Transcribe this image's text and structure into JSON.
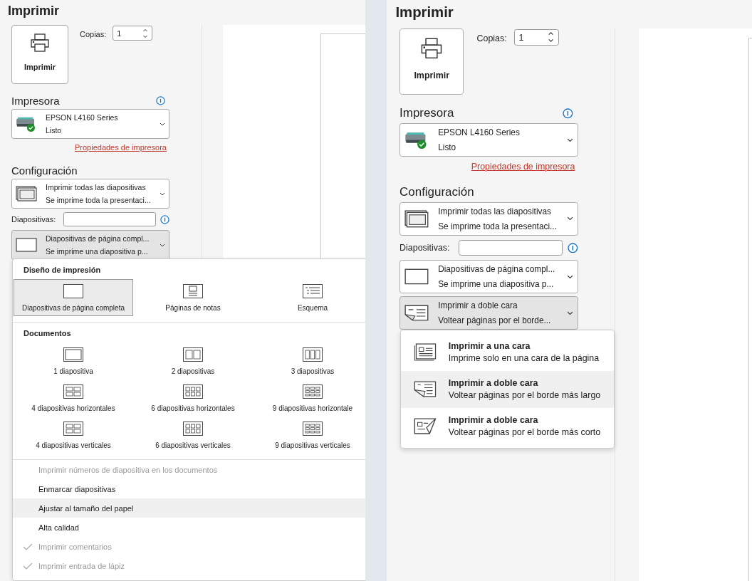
{
  "panels": [
    {
      "title": "Imprimir",
      "print_button": "Imprimir",
      "copies_label": "Copias:",
      "copies_value": "1",
      "printer_heading": "Impresora",
      "printer": {
        "name": "EPSON L4160 Series",
        "status": "Listo"
      },
      "printer_properties_link": "Propiedades de impresora",
      "settings_heading": "Configuración",
      "settings": [
        {
          "kind": "range",
          "title": "Imprimir todas las diapositivas",
          "subtitle": "Se imprime toda la presentaci...",
          "expanded": false
        },
        {
          "kind": "slides",
          "label": "Diapositivas:"
        },
        {
          "kind": "layout",
          "title": "Diapositivas de página compl...",
          "subtitle": "Se imprime una diapositiva p...",
          "expanded": true,
          "menu": {
            "kind": "layout-grid",
            "sections": [
              {
                "heading": "Diseño de impresión",
                "options": [
                  {
                    "kind": "full",
                    "label": "Diapositivas de página completa",
                    "selected": true
                  },
                  {
                    "kind": "notes",
                    "label": "Páginas de notas",
                    "selected": false
                  },
                  {
                    "kind": "outline",
                    "label": "Esquema",
                    "selected": false
                  }
                ]
              },
              {
                "heading": "Documentos",
                "options": [
                  {
                    "kind": "single",
                    "label": "1 diapositiva",
                    "selected": false
                  },
                  {
                    "kind": "double",
                    "label": "2 diapositivas",
                    "selected": false
                  },
                  {
                    "kind": "triple",
                    "label": "3 diapositivas",
                    "selected": false
                  },
                  {
                    "kind": "fourwide",
                    "label": "4 diapositivas horizontales",
                    "selected": false
                  },
                  {
                    "kind": "sixwide",
                    "label": "6 diapositivas horizontales",
                    "selected": false
                  },
                  {
                    "kind": "ninewide",
                    "label": "9 diapositivas horizontale",
                    "selected": false
                  },
                  {
                    "kind": "fourtall",
                    "label": "4 diapositivas verticales",
                    "selected": false
                  },
                  {
                    "kind": "sixtall",
                    "label": "6 diapositivas verticales",
                    "selected": false
                  },
                  {
                    "kind": "ninetall",
                    "label": "9 diapositivas verticales",
                    "selected": false
                  }
                ]
              }
            ],
            "toggles": [
              {
                "label": "Imprimir números de diapositiva en los documentos",
                "checked": false,
                "disabled": true,
                "highlighted": false
              },
              {
                "label": "Enmarcar diapositivas",
                "checked": false,
                "disabled": false,
                "highlighted": false
              },
              {
                "label": "Ajustar al tamaño del papel",
                "checked": false,
                "disabled": false,
                "highlighted": true
              },
              {
                "label": "Alta calidad",
                "checked": false,
                "disabled": false,
                "highlighted": false
              },
              {
                "label": "Imprimir comentarios",
                "checked": true,
                "disabled": true,
                "highlighted": false
              },
              {
                "label": "Imprimir entrada de lápiz",
                "checked": true,
                "disabled": true,
                "highlighted": false
              }
            ]
          }
        }
      ]
    },
    {
      "title": "Imprimir",
      "print_button": "Imprimir",
      "copies_label": "Copias:",
      "copies_value": "1",
      "printer_heading": "Impresora",
      "printer": {
        "name": "EPSON L4160 Series",
        "status": "Listo"
      },
      "printer_properties_link": "Propiedades de impresora",
      "settings_heading": "Configuración",
      "settings": [
        {
          "kind": "range",
          "title": "Imprimir todas las diapositivas",
          "subtitle": "Se imprime toda la presentaci...",
          "expanded": false
        },
        {
          "kind": "slides",
          "label": "Diapositivas:"
        },
        {
          "kind": "layout",
          "title": "Diapositivas de página compl...",
          "subtitle": "Se imprime una diapositiva p...",
          "expanded": false
        },
        {
          "kind": "sides",
          "title": "Imprimir a doble cara",
          "subtitle": "Voltear páginas por el borde...",
          "expanded": true,
          "menu": {
            "kind": "option-list",
            "options": [
              {
                "kind": "one-sided",
                "title": "Imprimir a una cara",
                "subtitle": "Imprime solo en una cara de la página",
                "selected": false
              },
              {
                "kind": "long-edge",
                "title": "Imprimir a doble cara",
                "subtitle": "Voltear páginas por el borde más largo",
                "selected": true
              },
              {
                "kind": "short-edge",
                "title": "Imprimir a doble cara",
                "subtitle": "Voltear páginas por el borde más corto",
                "selected": false
              }
            ]
          }
        }
      ]
    }
  ]
}
